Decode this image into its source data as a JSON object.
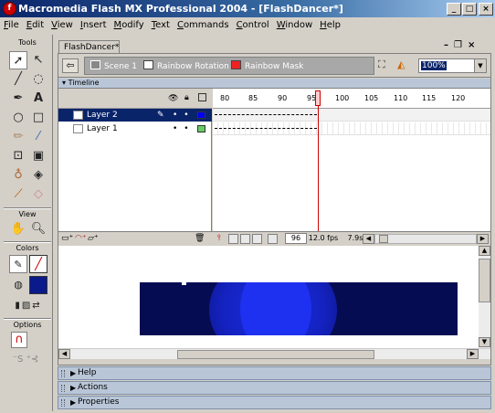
{
  "window": {
    "title": "Macromedia Flash MX Professional 2004 - [FlashDancer*]"
  },
  "menu": [
    "File",
    "Edit",
    "View",
    "Insert",
    "Modify",
    "Text",
    "Commands",
    "Control",
    "Window",
    "Help"
  ],
  "tools": {
    "header": "Tools",
    "view_label": "View",
    "colors_label": "Colors",
    "options_label": "Options"
  },
  "document": {
    "tab": "FlashDancer*",
    "breadcrumbs": [
      "Scene 1",
      "Rainbow Rotation",
      "Rainbow Mask"
    ],
    "zoom": "100%"
  },
  "timeline": {
    "label": "Timeline",
    "ruler": [
      "80",
      "85",
      "90",
      "95",
      "100",
      "105",
      "110",
      "115",
      "120"
    ],
    "layers": [
      {
        "name": "Layer 2",
        "color": "#0000ff",
        "selected": true
      },
      {
        "name": "Layer 1",
        "color": "#66cc66",
        "selected": false
      }
    ],
    "current_frame": "96",
    "fps": "12.0 fps",
    "elapsed": "7.9s"
  },
  "colors": {
    "stage_bg": "#060c52",
    "glow": "#1a2ee0",
    "title_bar": "#0a246a",
    "panel_bar": "#b9c6d8"
  },
  "panels": [
    "Help",
    "Actions",
    "Properties"
  ]
}
